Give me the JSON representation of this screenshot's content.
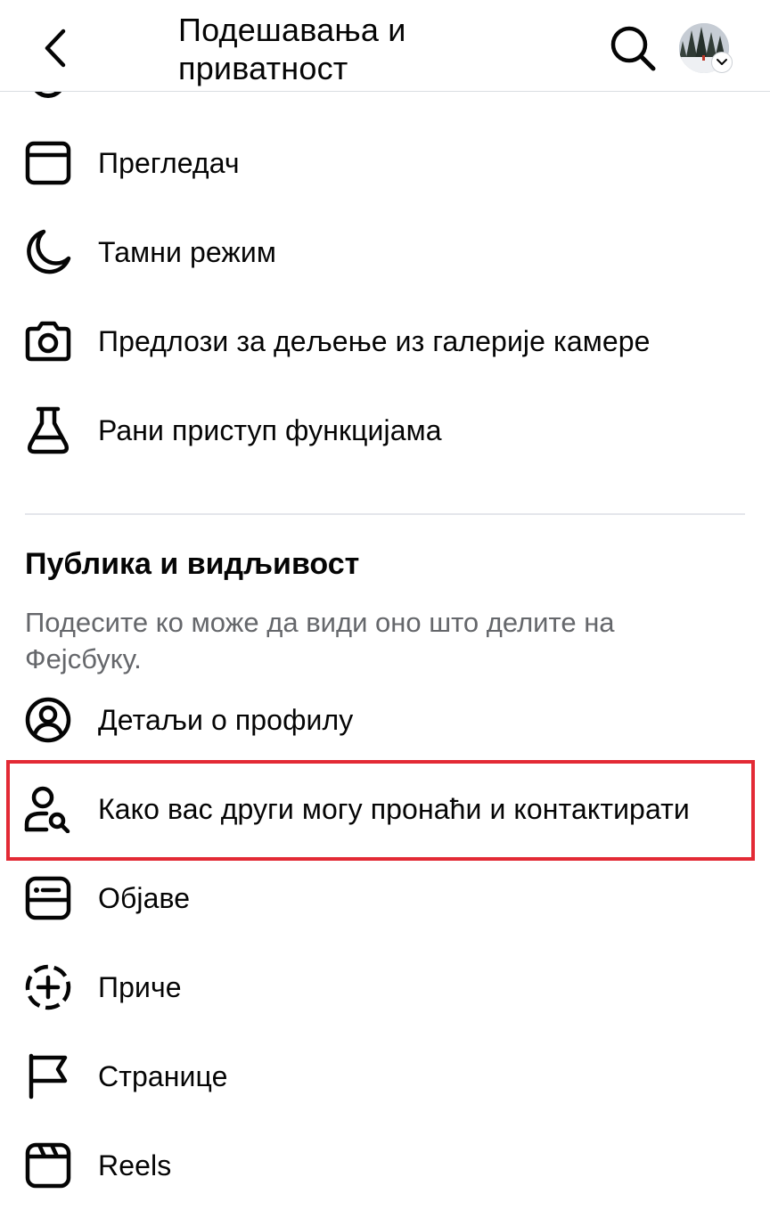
{
  "header": {
    "title_line1": "Подешавања и",
    "title_line2": "приватност",
    "back_icon": "chevron-left-icon",
    "search_icon": "search-icon",
    "avatar_icon": "avatar",
    "avatar_badge_icon": "chevron-down-icon"
  },
  "items_top": [
    {
      "label": "Прегледач",
      "icon": "browser-window-icon"
    },
    {
      "label": "Тамни режим",
      "icon": "moon-icon"
    },
    {
      "label": "Предлози за дељење из галерије камере",
      "icon": "camera-icon"
    },
    {
      "label": "Рани приступ функцијама",
      "icon": "flask-icon"
    }
  ],
  "section": {
    "heading": "Публика и видљивост",
    "description": "Подесите ко може да види оно што делите на Фејсбуку."
  },
  "items_section": [
    {
      "label": "Детаљи о профилу",
      "icon": "profile-circle-icon"
    },
    {
      "label": "Како вас други могу пронаћи и контактирати",
      "icon": "person-search-icon",
      "highlighted": true
    },
    {
      "label": "Објаве",
      "icon": "posts-card-icon"
    },
    {
      "label": "Приче",
      "icon": "story-plus-icon"
    },
    {
      "label": "Странице",
      "icon": "flag-icon"
    },
    {
      "label": "Reels",
      "icon": "reels-icon"
    }
  ],
  "colors": {
    "highlight": "#e32a35",
    "text_primary": "#050505",
    "text_secondary": "#65676b",
    "divider": "#e4e6eb"
  }
}
